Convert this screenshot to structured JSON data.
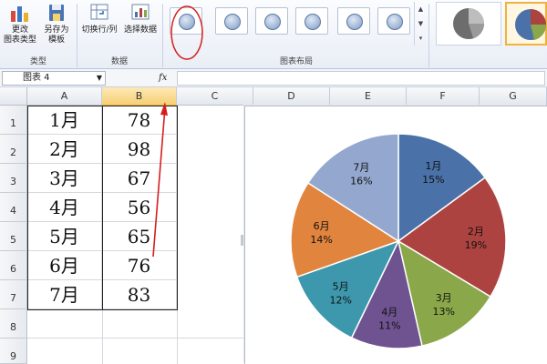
{
  "ribbon": {
    "change_type_label_1": "更改",
    "change_type_label_2": "图表类型",
    "save_template_label_1": "另存为",
    "save_template_label_2": "模板",
    "switch_rowcol_label": "切换行/列",
    "select_data_label": "选择数据",
    "group_type": "类型",
    "group_data": "数据",
    "group_layout": "图表布局"
  },
  "formula_bar": {
    "name_box": "图表 4",
    "fx": "fx",
    "formula": ""
  },
  "columns": [
    "A",
    "B",
    "C",
    "D",
    "E",
    "F",
    "G"
  ],
  "rows": [
    "1",
    "2",
    "3",
    "4",
    "5",
    "6",
    "7",
    "8",
    "9"
  ],
  "table": [
    {
      "month": "1月",
      "value": "78"
    },
    {
      "month": "2月",
      "value": "98"
    },
    {
      "month": "3月",
      "value": "67"
    },
    {
      "month": "4月",
      "value": "56"
    },
    {
      "month": "5月",
      "value": "65"
    },
    {
      "month": "6月",
      "value": "76"
    },
    {
      "month": "7月",
      "value": "83"
    }
  ],
  "chart_data": {
    "type": "pie",
    "categories": [
      "1月",
      "2月",
      "3月",
      "4月",
      "5月",
      "6月",
      "7月"
    ],
    "values": [
      78,
      98,
      67,
      56,
      65,
      76,
      83
    ],
    "percent_labels": [
      "15%",
      "19%",
      "13%",
      "11%",
      "12%",
      "14%",
      "16%"
    ],
    "colors": [
      "#4a72a8",
      "#ad4341",
      "#8aa84a",
      "#6f5390",
      "#3d98ae",
      "#e0843e",
      "#94a8cf"
    ],
    "title": ""
  },
  "colors": {
    "selected_column": "#f7cf74",
    "annotation_red": "#d51f1f"
  }
}
